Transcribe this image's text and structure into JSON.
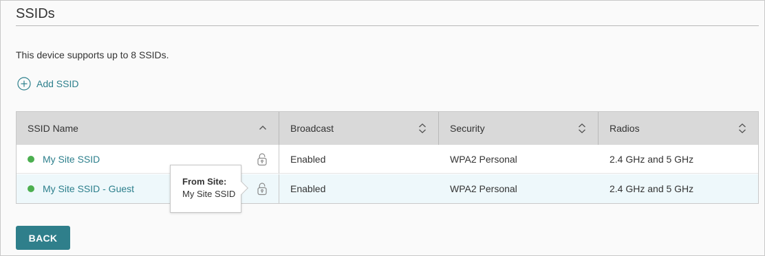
{
  "section": {
    "title": "SSIDs",
    "info": "This device supports up to 8 SSIDs.",
    "add_label": "Add SSID"
  },
  "table": {
    "columns": [
      {
        "label": "SSID Name",
        "sort": "ascending"
      },
      {
        "label": "Broadcast",
        "sort": "none"
      },
      {
        "label": "Security",
        "sort": "none"
      },
      {
        "label": "Radios",
        "sort": "none"
      }
    ],
    "rows": [
      {
        "name": "My Site SSID",
        "status": "active",
        "locked": true,
        "broadcast": "Enabled",
        "security": "WPA2 Personal",
        "radios": "2.4 GHz and 5 GHz"
      },
      {
        "name": "My Site SSID - Guest",
        "status": "active",
        "locked": true,
        "broadcast": "Enabled",
        "security": "WPA2 Personal",
        "radios": "2.4 GHz and 5 GHz"
      }
    ]
  },
  "tooltip": {
    "title": "From Site:",
    "value": "My Site SSID"
  },
  "actions": {
    "back_label": "BACK"
  },
  "colors": {
    "accent": "#2c7f8c",
    "status_active": "#4caf50",
    "header_bg": "#d9d9d9",
    "row_highlight": "#eef8fb"
  },
  "icons": {
    "add": "plus-circle-icon",
    "sort_asc": "chevron-up-icon",
    "sort_both": "sort-both-icon",
    "lock": "lock-icon"
  }
}
